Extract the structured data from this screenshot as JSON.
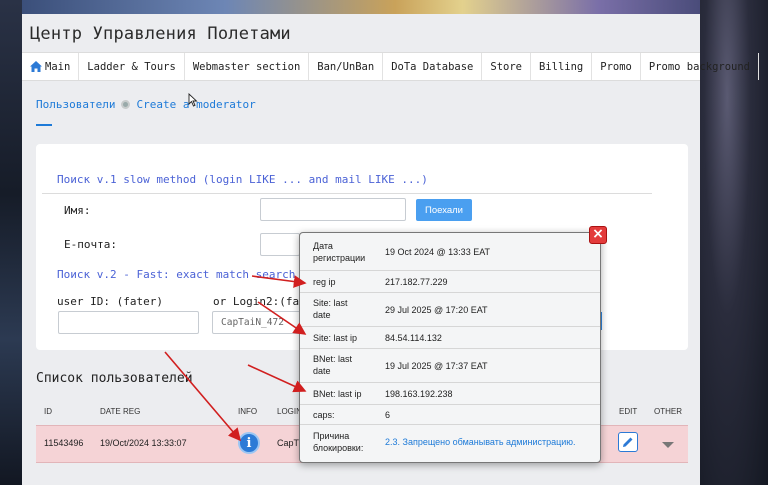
{
  "site_title": "Центр Управления Полетами",
  "nav": [
    "Main",
    "Ladder & Tours",
    "Webmaster section",
    "Ban/UnBan",
    "DoTa Database",
    "Store",
    "Billing",
    "Promo",
    "Promo background"
  ],
  "breadcrumb": {
    "users": "Пользователи",
    "create": "Create a moderator"
  },
  "search_v1": {
    "title": "Поиск v.1 slow method (login LIKE ... and mail LIKE ...)",
    "name_label": "Имя:",
    "email_label": "E-почта:",
    "go_button": "Поехали"
  },
  "search_v2": {
    "title": "Поиск v.2 - Fast: exact match search (u",
    "userid_label": "user ID: (fater)",
    "login_label": "or Login2:(fa",
    "login_value": "CapTaiN_472"
  },
  "users_list": {
    "title": "Список пользователей",
    "columns": {
      "id": "ID",
      "date_reg": "DATE REG",
      "info": "INFO",
      "login": "LOGIN",
      "edit": "EDIT",
      "other": "OTHER"
    },
    "row": {
      "id": "11543496",
      "date_reg": "19/Oct/2024 13:33:07",
      "login": "CapT"
    }
  },
  "popup": {
    "rows": [
      {
        "key": "Дата регистрации",
        "value": "19 Oct 2024 @ 13:33 EAT"
      },
      {
        "key": "reg ip",
        "value": "217.182.77.229"
      },
      {
        "key": "Site: last date",
        "value": "29 Jul 2025 @ 17:20 EAT"
      },
      {
        "key": "Site: last ip",
        "value": "84.54.114.132"
      },
      {
        "key": "BNet: last date",
        "value": "19 Jul 2025 @ 17:37 EAT"
      },
      {
        "key": "BNet: last ip",
        "value": "198.163.192.238"
      },
      {
        "key": "caps:",
        "value": "6"
      },
      {
        "key": "Причина блокировки:",
        "value": "2.3. Запрещено обманывать администрацию."
      }
    ]
  },
  "colors": {
    "link_blue": "#1d7ad8",
    "search_title": "#4b62d6",
    "row_highlight": "#f5d3d6",
    "arrow_red": "#d11f1f"
  }
}
